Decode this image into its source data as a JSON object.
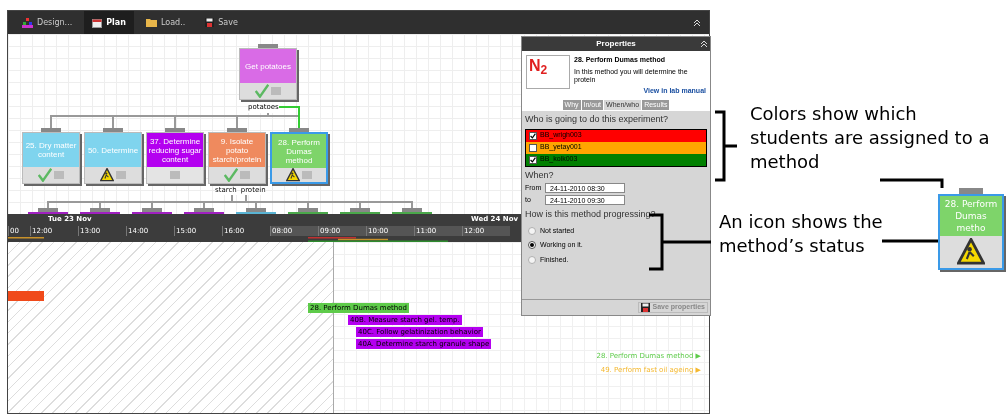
{
  "toolbar": {
    "tabs": [
      {
        "label": "Design...",
        "selected": false
      },
      {
        "label": "Plan",
        "selected": true
      },
      {
        "label": "Load..",
        "selected": false
      },
      {
        "label": "Save",
        "selected": false
      }
    ]
  },
  "tree": {
    "root": {
      "label": "Get potatoes",
      "color": "#d96be6",
      "finished": true,
      "in_progress": false,
      "output": "potatoes"
    },
    "methods": [
      {
        "label": "25. Dry matter content",
        "color": "#7fd4ee",
        "finished": true,
        "in_progress": false,
        "selected": false
      },
      {
        "label": "50. Determine",
        "color": "#7fd4ee",
        "finished": false,
        "in_progress": true,
        "selected": false
      },
      {
        "label": "37. Determine reducing sugar content",
        "color": "#b400f0",
        "finished": false,
        "in_progress": false,
        "selected": false
      },
      {
        "label": "9. Isolate potato starch/protein",
        "color": "#ef8a5e",
        "finished": true,
        "in_progress": false,
        "selected": false
      },
      {
        "label": "28. Perform Dumas method",
        "color": "#7ed46a",
        "finished": false,
        "in_progress": true,
        "selected": true
      }
    ],
    "outputs": [
      "starch",
      "protein"
    ],
    "next_methods": [
      {
        "color": "#a020c0"
      },
      {
        "color": "#a020c0"
      },
      {
        "color": "#a020c0"
      },
      {
        "color": "#a020c0"
      },
      {
        "color": "#5ab4d4"
      },
      {
        "color": "#4aa84a"
      },
      {
        "color": "#4aa84a"
      },
      {
        "color": "#4aa84a"
      }
    ]
  },
  "timeline": {
    "days": [
      "Tue 23 Nov",
      "Wed 24 Nov"
    ],
    "hours": [
      "00",
      "12:00",
      "13:00",
      "14:00",
      "15:00",
      "16:00",
      "08:00",
      "09:00",
      "10:00",
      "11:00",
      "12:00"
    ]
  },
  "schedule": {
    "tasks": [
      {
        "label": "28. Perform Dumas method",
        "color": "#5ecb4a"
      },
      {
        "label": "40B. Measure starch gel. temp.",
        "color": "#b400f0"
      },
      {
        "label": "40C. Follow gelatinization behavior",
        "color": "#b400f0"
      },
      {
        "label": "40A. Determine starch granule shape",
        "color": "#b400f0"
      }
    ],
    "offscreen": [
      {
        "label": "28. Perform Dumas method ▶",
        "color": "#5ecb4a"
      },
      {
        "label": "49. Perform fast oil ageing ▶",
        "color": "#f5b82e"
      }
    ]
  },
  "properties": {
    "title": "Properties",
    "logo_text": "N$_{2}$",
    "method": "28. Perform Dumas method",
    "description": "In this method you will determine the protein",
    "link": "View in lab manual",
    "tabs": [
      {
        "label": "Why",
        "selected": false
      },
      {
        "label": "In/out",
        "selected": false
      },
      {
        "label": "When/who",
        "selected": true
      },
      {
        "label": "Results",
        "selected": false
      }
    ],
    "who_question": "Who is going to do this experiment?",
    "students": [
      {
        "name": "BB_wrigh003",
        "checked": true,
        "color": "#ff0000"
      },
      {
        "name": "BB_yetay001",
        "checked": false,
        "color": "#ffa500"
      },
      {
        "name": "BB_kolk003",
        "checked": true,
        "color": "#008000"
      }
    ],
    "when_label": "When?",
    "from_label": "From",
    "from": "24-11-2010 08:30",
    "to_label": "to",
    "to": "24-11-2010 09:30",
    "progress_question": "How is this method progressing?",
    "progress_options": [
      {
        "label": "Not started",
        "selected": false
      },
      {
        "label": "Working on it.",
        "selected": true
      },
      {
        "label": "Finished.",
        "selected": false
      }
    ],
    "save_button": "Save properties"
  },
  "annotations": [
    {
      "text": "Colors show which students are assigned to a method"
    },
    {
      "text": "An icon shows the method’s status"
    }
  ],
  "zoomed_node": {
    "label": "28. Perform Dumas metho",
    "color": "#7ed46a",
    "finished": false,
    "in_progress": true
  }
}
